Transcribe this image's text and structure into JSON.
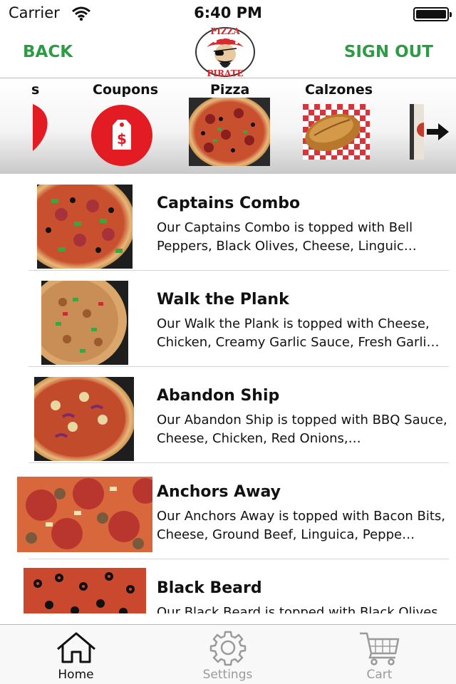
{
  "status": {
    "carrier": "Carrier",
    "time": "6:40 PM"
  },
  "nav": {
    "back": "BACK",
    "signout": "SIGN OUT",
    "logo_line1": "PIZZA",
    "logo_line2": "PIRATE"
  },
  "categories": [
    {
      "label": "s",
      "icon": "heart-icon"
    },
    {
      "label": "Coupons",
      "icon": "price-tag-icon"
    },
    {
      "label": "Pizza",
      "icon": "pizza-photo"
    },
    {
      "label": "Calzones",
      "icon": "calzone-photo"
    },
    {
      "label": "",
      "icon": "partial-photo"
    }
  ],
  "scroll_arrow_icon": "arrow-right-icon",
  "items": [
    {
      "title": "Captains Combo",
      "desc": "Our Captains Combo is topped with Bell Peppers, Black Olives, Cheese, Linguic…"
    },
    {
      "title": "Walk the Plank",
      "desc": "Our Walk the Plank is topped with Cheese, Chicken, Creamy Garlic Sauce, Fresh Garli…"
    },
    {
      "title": "Abandon Ship",
      "desc": "Our Abandon Ship is topped with BBQ Sauce, Cheese, Chicken, Red Onions,…"
    },
    {
      "title": "Anchors Away",
      "desc": "Our Anchors Away is topped with Bacon Bits, Cheese, Ground Beef, Linguica, Peppe…"
    },
    {
      "title": "Black Beard",
      "desc": "Our Black Beard is topped with Black Olives,"
    }
  ],
  "tabs": [
    {
      "label": "Home",
      "icon": "home-icon",
      "active": true
    },
    {
      "label": "Settings",
      "icon": "gear-icon",
      "active": false
    },
    {
      "label": "Cart",
      "icon": "cart-icon",
      "active": false
    }
  ],
  "colors": {
    "accent": "#2e9b45",
    "coupon": "#e31b23",
    "inactive_tab": "#9a9a9a"
  }
}
